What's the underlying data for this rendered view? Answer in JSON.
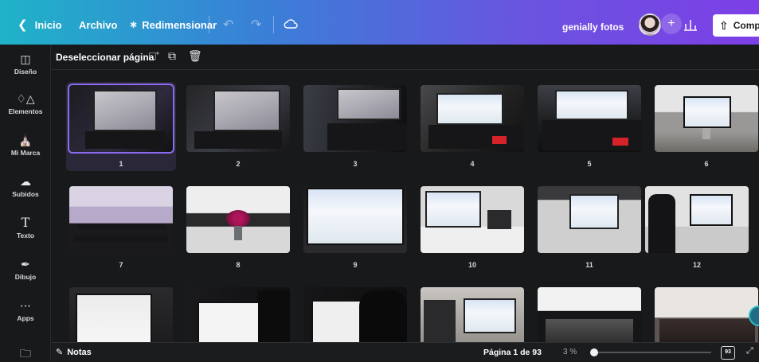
{
  "topbar": {
    "back_label": "Inicio",
    "file_label": "Archivo",
    "resize_label": "Redimensionar",
    "user_name": "genially fotos",
    "share_label": "Compa",
    "plus_label": "+"
  },
  "sidebar": {
    "items": [
      {
        "label": "Diseño",
        "icon": "layout-icon"
      },
      {
        "label": "Elementos",
        "icon": "shapes-icon"
      },
      {
        "label": "Mi Marca",
        "icon": "brand-icon"
      },
      {
        "label": "Subidos",
        "icon": "cloud-upload-icon"
      },
      {
        "label": "Texto",
        "icon": "text-icon"
      },
      {
        "label": "Dibujo",
        "icon": "draw-icon"
      },
      {
        "label": "Apps",
        "icon": "apps-grid-icon"
      },
      {
        "label": "",
        "icon": "folder-icon"
      }
    ]
  },
  "toolbar": {
    "deselect_label": "Deseleccionar página"
  },
  "pages": [
    {
      "number": "1",
      "selected": true
    },
    {
      "number": "2"
    },
    {
      "number": "3"
    },
    {
      "number": "4"
    },
    {
      "number": "5"
    },
    {
      "number": "6"
    },
    {
      "number": "7"
    },
    {
      "number": "8"
    },
    {
      "number": "9"
    },
    {
      "number": "10"
    },
    {
      "number": "11"
    },
    {
      "number": "12"
    },
    {
      "number": ""
    },
    {
      "number": ""
    },
    {
      "number": ""
    },
    {
      "number": ""
    },
    {
      "number": ""
    },
    {
      "number": ""
    }
  ],
  "bottombar": {
    "notes_label": "Notas",
    "page_indicator": "Página 1 de 93",
    "zoom": "3 %",
    "zoom_level": 0.03,
    "page_count_badge": "93"
  },
  "colors": {
    "accent": "#8b6cf0",
    "topbar_start": "#1fb3c8",
    "topbar_end": "#7d3fe6"
  }
}
